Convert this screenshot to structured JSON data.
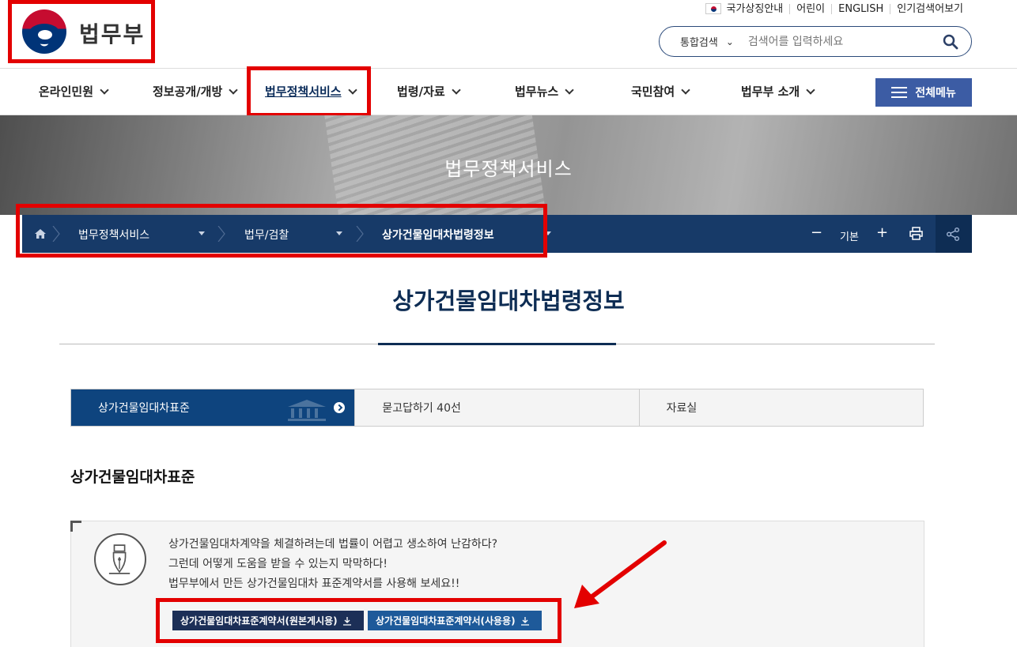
{
  "header": {
    "logo_text": "법무부",
    "util_links": [
      "국가상징안내",
      "어린이",
      "ENGLISH",
      "인기검색어보기"
    ],
    "search": {
      "scope": "통합검색",
      "placeholder": "검색어를 입력하세요"
    }
  },
  "gnb": {
    "items": [
      "온라인민원",
      "정보공개/개방",
      "법무정책서비스",
      "법령/자료",
      "법무뉴스",
      "국민참여",
      "법무부 소개"
    ],
    "active_index": 2,
    "all_menu_label": "전체메뉴"
  },
  "visual": {
    "title": "법무정책서비스"
  },
  "breadcrumb": {
    "items": [
      "법무정책서비스",
      "법무/검찰",
      "상가건물임대차법령정보"
    ],
    "font_controls": {
      "minus": "−",
      "label": "기본",
      "plus": "+"
    }
  },
  "page": {
    "title": "상가건물임대차법령정보"
  },
  "tabs": [
    "상가건물임대차표준",
    "묻고답하기 40선",
    "자료실"
  ],
  "content": {
    "section_title": "상가건물임대차표준",
    "desc_lines": [
      "상가건물임대차계약을 체결하려는데 법률이 어렵고 생소하여 난감하다?",
      "그런데 어떻게 도움을 받을 수 있는지 막막하다!",
      "법무부에서 만든 상가건물임대차 표준계약서를 사용해 보세요!!"
    ],
    "buttons": [
      "상가건물임대차표준계약서(원본게시용)",
      "상가건물임대차표준계약서(사용용)"
    ]
  },
  "colors": {
    "navy": "#0e2d54",
    "accent_blue": "#3c5ca4",
    "highlight_red": "#e30000"
  }
}
